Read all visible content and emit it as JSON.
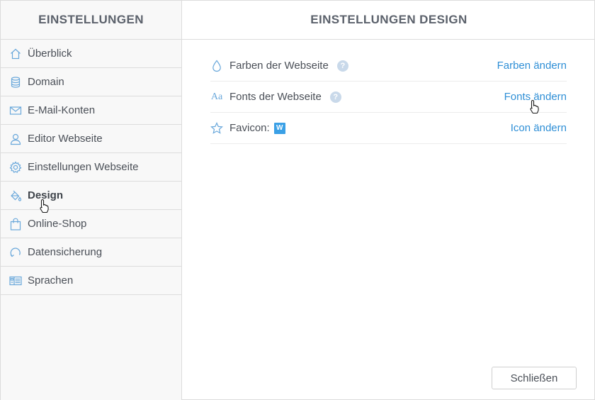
{
  "sidebar": {
    "title": "EINSTELLUNGEN",
    "items": [
      {
        "label": "Überblick",
        "icon": "home-icon"
      },
      {
        "label": "Domain",
        "icon": "database-icon"
      },
      {
        "label": "E-Mail-Konten",
        "icon": "envelope-icon"
      },
      {
        "label": "Editor Webseite",
        "icon": "user-icon"
      },
      {
        "label": "Einstellungen Webseite",
        "icon": "gear-icon"
      },
      {
        "label": "Design",
        "icon": "paint-bucket-icon",
        "active": true
      },
      {
        "label": "Online-Shop",
        "icon": "shopping-bag-icon"
      },
      {
        "label": "Datensicherung",
        "icon": "backup-icon"
      },
      {
        "label": "Sprachen",
        "icon": "languages-icon"
      }
    ]
  },
  "main": {
    "title": "EINSTELLUNGEN DESIGN",
    "rows": [
      {
        "label": "Farben der Webseite",
        "icon": "drop-icon",
        "help": "?",
        "action": "Farben ändern"
      },
      {
        "label": "Fonts der Webseite",
        "icon": "font-icon",
        "icon_text": "Aa",
        "help": "?",
        "action": "Fonts ändern"
      },
      {
        "label": "Favicon:",
        "icon": "star-icon",
        "badge": "W",
        "action": "Icon ändern"
      }
    ],
    "close_label": "Schließen"
  },
  "colors": {
    "accent": "#2f8fd6",
    "icon": "#6aa8db",
    "border": "#dcdcdc"
  }
}
